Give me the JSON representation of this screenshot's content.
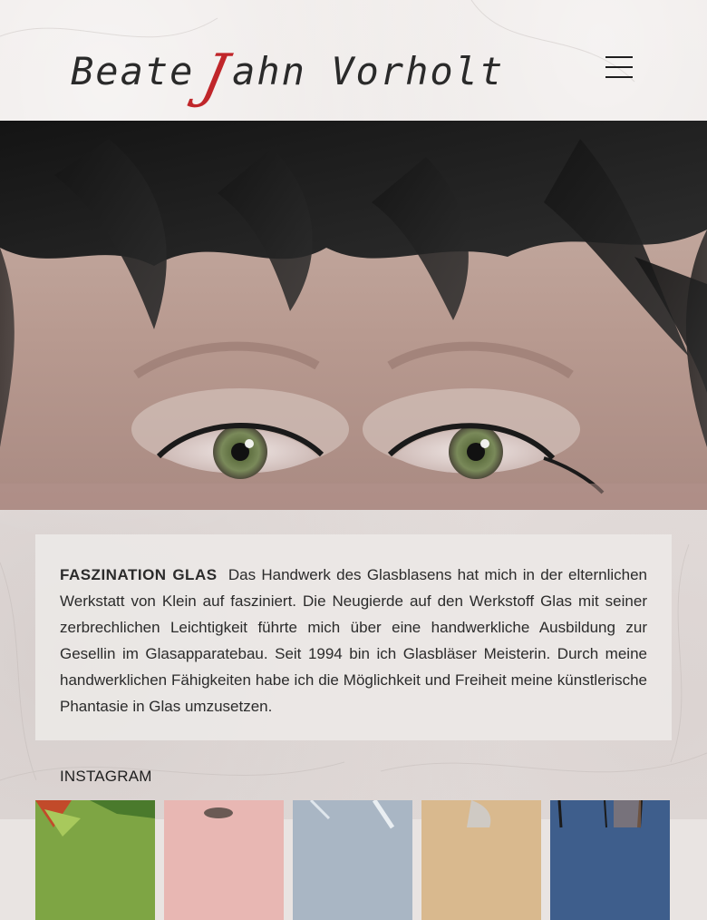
{
  "header": {
    "logo": {
      "first": "Beate",
      "initial": "J",
      "rest": "ahn Vorholt",
      "initial_color": "#c0262a"
    },
    "menu_icon": "hamburger-menu-icon"
  },
  "hero": {
    "image": "close-up-eyes-with-black-feathers"
  },
  "intro": {
    "heading": "FASZINATION GLAS",
    "body": "Das Handwerk des Glasblasens hat mich in der elternlichen Werkstatt von Klein auf fasziniert. Die Neugierde auf den Werkstoff Glas mit seiner zerbrechlichen Leichtigkeit führte mich über eine handwerkliche Ausbildung zur Gesellin im Glasapparatebau. Seit 1994 bin ich Glasbläser Meisterin. Durch meine handwerklichen Fähigkeiten habe ich die Möglichkeit und Freiheit meine künstlerische Phantasie in Glas umzusetzen."
  },
  "instagram": {
    "heading": "INSTAGRAM",
    "thumbs": [
      {
        "subject": "green-plant",
        "color": "#7ea544"
      },
      {
        "subject": "pink-object",
        "color": "#e8b7b3"
      },
      {
        "subject": "snowy-branches",
        "color": "#a9b6c4"
      },
      {
        "subject": "glass-figure",
        "color": "#d9b98e"
      },
      {
        "subject": "winter-trees",
        "color": "#3e5e8c"
      }
    ]
  },
  "colors": {
    "background": "#e9e4e2",
    "text": "#2b2b2b",
    "accent": "#c0262a"
  }
}
